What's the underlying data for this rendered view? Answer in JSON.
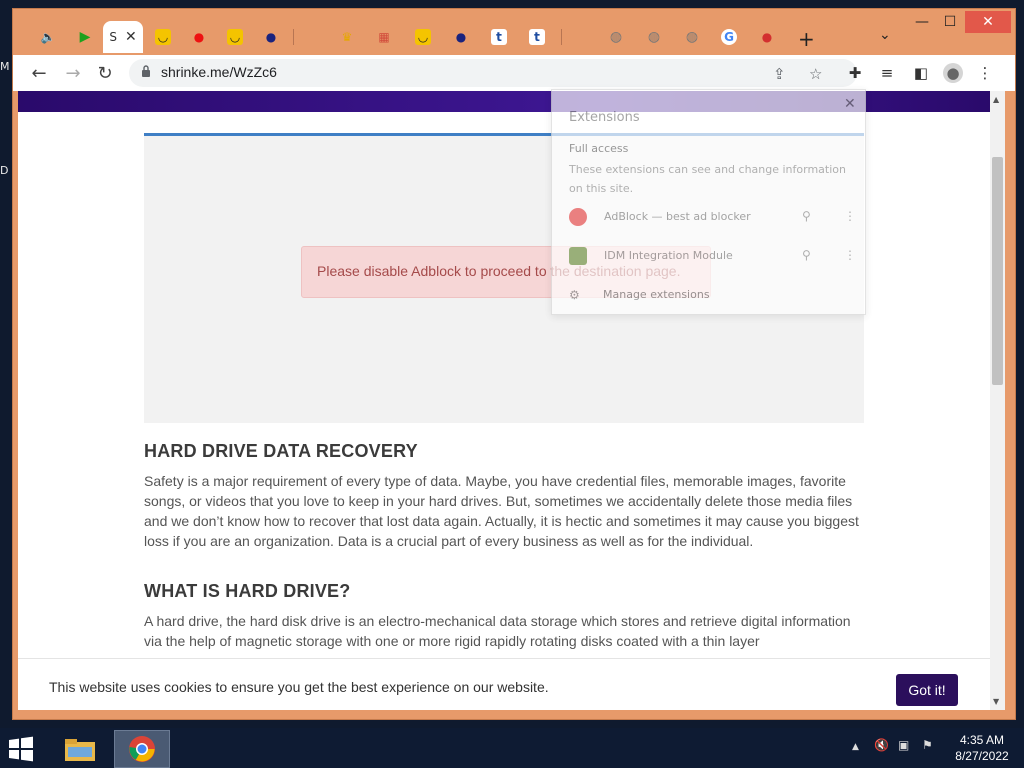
{
  "desktop": {
    "edge_labels": [
      "M",
      "D"
    ]
  },
  "window": {
    "tabs": [
      {
        "name": "tab-1",
        "fav_text": "🔈",
        "fav_color": "#222"
      },
      {
        "name": "tab-2",
        "fav_text": "▶",
        "fav_color": "#1da11d"
      },
      {
        "name": "tab-active",
        "title": "S",
        "close": "✕"
      },
      {
        "name": "tab-4",
        "fav_text": "◡",
        "fav_color": "#f4c400"
      },
      {
        "name": "tab-5",
        "fav_text": "●",
        "fav_color": "#e11"
      },
      {
        "name": "tab-6",
        "fav_text": "◡",
        "fav_color": "#f4c400"
      },
      {
        "name": "tab-7",
        "fav_text": "●",
        "fav_color": "#1a237e"
      },
      {
        "name": "tab-8",
        "fav_text": "",
        "fav_color": "#ccc"
      },
      {
        "name": "tab-9",
        "fav_text": "♛",
        "fav_color": "#e5a800"
      },
      {
        "name": "tab-10",
        "fav_text": "▦",
        "fav_color": "#d14a3a"
      },
      {
        "name": "tab-11",
        "fav_text": "◡",
        "fav_color": "#f4c400"
      },
      {
        "name": "tab-12",
        "fav_text": "●",
        "fav_color": "#1a237e"
      },
      {
        "name": "tab-13",
        "fav_text": "t",
        "fav_color": "#1e4da1"
      },
      {
        "name": "tab-14",
        "fav_text": "t",
        "fav_color": "#1e4da1"
      },
      {
        "name": "tab-15",
        "fav_text": "",
        "fav_color": "#ccc"
      },
      {
        "name": "tab-16",
        "fav_text": "◍",
        "fav_color": "#777"
      },
      {
        "name": "tab-17",
        "fav_text": "◍",
        "fav_color": "#777"
      },
      {
        "name": "tab-18",
        "fav_text": "◍",
        "fav_color": "#777"
      },
      {
        "name": "tab-19",
        "fav_text": "G",
        "fav_color": "#4285f4"
      },
      {
        "name": "tab-20",
        "fav_text": "●",
        "fav_color": "#d32f2f"
      }
    ],
    "new_tab": "+",
    "tab_search": "⌄",
    "controls": {
      "minimize": "—",
      "maximize": "☐",
      "close": "✕"
    }
  },
  "toolbar": {
    "url": "shrinke.me/WzZc6",
    "back": "←",
    "forward": "→",
    "reload": "↻",
    "share": "⇪",
    "star": "☆",
    "extensions": "✚",
    "media": "≡",
    "sidepanel": "◧",
    "profile": "●",
    "menu": "⋮"
  },
  "page": {
    "ad_alert": "Please disable Adblock to proceed to the destination page.",
    "sections": [
      {
        "heading": "HARD DRIVE DATA RECOVERY",
        "text": "Safety is a major requirement of every type of data. Maybe, you have credential files, memorable images, favorite songs, or videos that you love to keep in your hard drives. But, sometimes we accidentally delete those media files and we don’t know how to recover that lost data again. Actually, it is hectic and sometimes it may cause you biggest loss if you are an organization. Data is a crucial part of every business as well as for the individual."
      },
      {
        "heading": "WHAT IS HARD DRIVE?",
        "text": "A hard drive, the hard disk drive is an electro-mechanical data storage which stores and retrieve digital information via the help of magnetic storage with one or more rigid rapidly rotating disks coated with a thin layer"
      }
    ],
    "cookie": {
      "message": "This website uses cookies to ensure you get the best experience on our website.",
      "button": "Got it!"
    }
  },
  "extensions_popup": {
    "title": "Extensions",
    "close": "✕",
    "full_access": "Full access",
    "description": "These extensions can see and change information on this site.",
    "items": [
      {
        "label": "AdBlock — best ad blocker",
        "pin": "⚲",
        "more": "⋮"
      },
      {
        "label": "IDM Integration Module",
        "pin": "⚲",
        "more": "⋮"
      }
    ],
    "manage": "Manage extensions"
  },
  "taskbar": {
    "tray_arrow": "▲",
    "time": "4:35 AM",
    "date": "8/27/2022"
  }
}
